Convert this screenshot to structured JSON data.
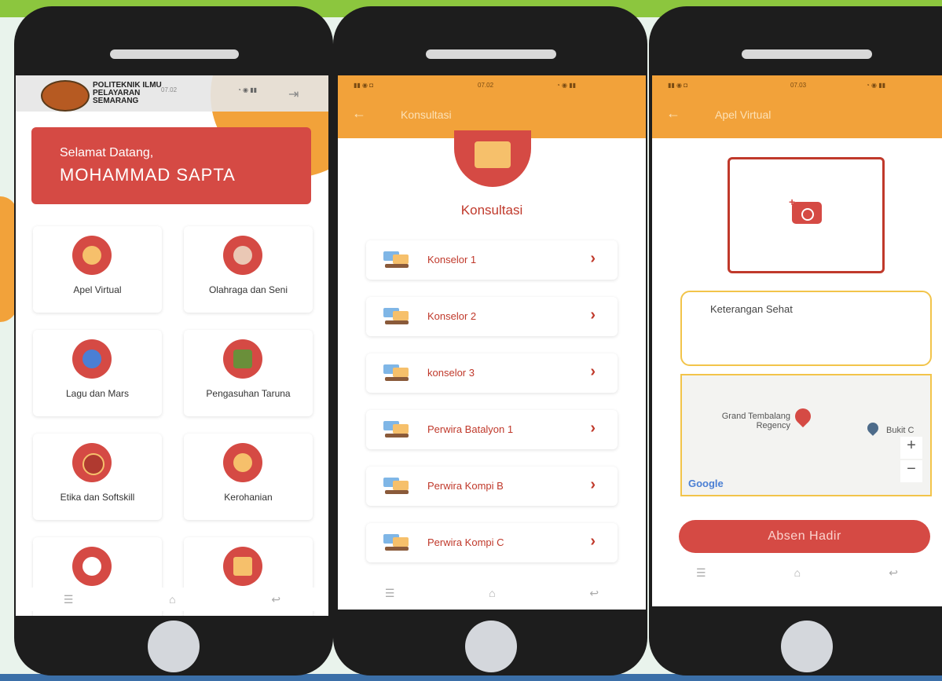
{
  "phone1": {
    "logo_text": "POLITEKNIK ILMU PELAYARAN SEMARANG",
    "time": "07.02",
    "welcome_line": "Selamat Datang,",
    "user_name": "MOHAMMAD SAPTA",
    "menu_items": [
      {
        "label": "Apel Virtual",
        "icon": "soldier-icon"
      },
      {
        "label": "Olahraga dan Seni",
        "icon": "sports-arts-icon"
      },
      {
        "label": "Lagu dan Mars",
        "icon": "music-icon"
      },
      {
        "label": "Pengasuhan Taruna",
        "icon": "house-icon"
      },
      {
        "label": "Etika dan Softskill",
        "icon": "mask-icon"
      },
      {
        "label": "Kerohanian",
        "icon": "prayer-icon"
      },
      {
        "label": "",
        "icon": "health-shield-icon"
      },
      {
        "label": "",
        "icon": "consultation-icon"
      }
    ]
  },
  "phone2": {
    "appbar_title": "Konsultasi",
    "time": "07.02",
    "heading": "Konsultasi",
    "items": [
      {
        "label": "Konselor 1"
      },
      {
        "label": "Konselor 2"
      },
      {
        "label": "konselor 3"
      },
      {
        "label": "Perwira Batalyon 1"
      },
      {
        "label": "Perwira Kompi B"
      },
      {
        "label": "Perwira Kompi C"
      }
    ]
  },
  "phone3": {
    "appbar_title": "Apel Virtual",
    "time": "07.03",
    "keterangan_label": "Keterangan Sehat",
    "map": {
      "place1": "Grand Tembalang\nRegency",
      "place2": "Bukit C",
      "zoom_in": "+",
      "zoom_out": "−",
      "attribution": "Google"
    },
    "submit_label": "Absen Hadir"
  },
  "nav_icons": [
    "menu-icon",
    "home-icon",
    "back-icon"
  ],
  "colors": {
    "primary_red": "#d54a44",
    "accent_orange": "#f2a23a",
    "field_border": "#f2c44a"
  }
}
